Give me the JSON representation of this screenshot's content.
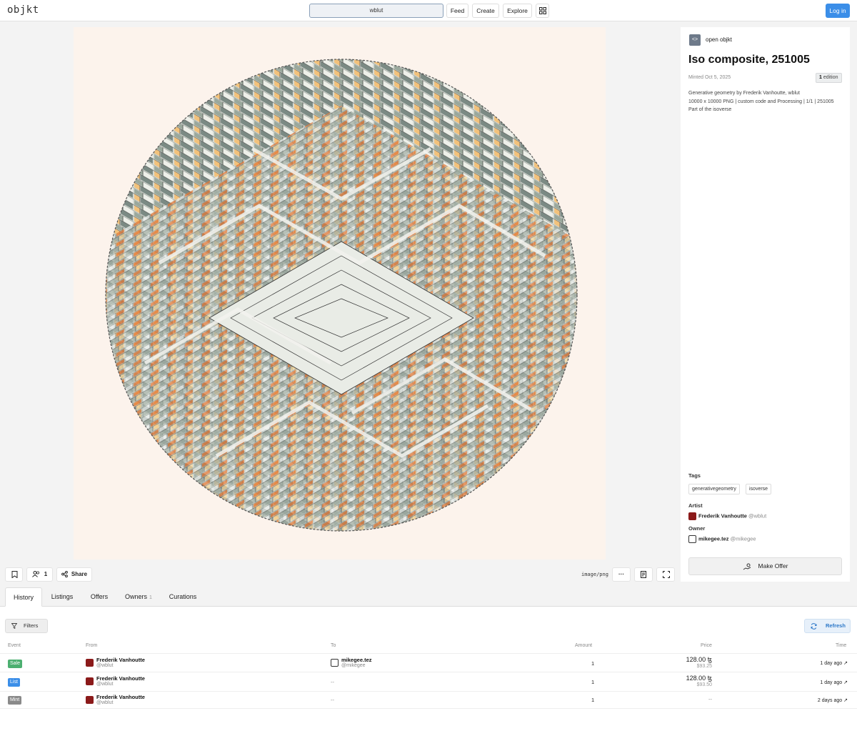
{
  "header": {
    "logo": "objkt",
    "search_value": "wblut",
    "nav": [
      "Feed",
      "Create",
      "Explore"
    ],
    "login_label": "Log in"
  },
  "token": {
    "collection_name": "open objkt",
    "title": "Iso composite, 251005",
    "minted": "Minted Oct 5, 2025",
    "edition_count": "1",
    "edition_label": "edition",
    "description": [
      "Generative geometry by Frederik Vanhoutte, wblut",
      "10000 x 10000 PNG | custom code and Processing | 1/1 | 251005",
      "Part of the isoverse"
    ],
    "tags_label": "Tags",
    "tags": [
      "generativegeometry",
      "isoverse"
    ],
    "artist_label": "Artist",
    "artist_name": "Frederik Vanhoutte",
    "artist_handle": "@wblut",
    "owner_label": "Owner",
    "owner_name": "mikegee.tez",
    "owner_handle": "@mikegee",
    "make_offer_label": "Make Offer"
  },
  "media_bar": {
    "owners_count": "1",
    "share_label": "Share",
    "mime": "image/png"
  },
  "tabs": [
    {
      "label": "History",
      "count": ""
    },
    {
      "label": "Listings",
      "count": ""
    },
    {
      "label": "Offers",
      "count": ""
    },
    {
      "label": "Owners",
      "count": "1"
    },
    {
      "label": "Curations",
      "count": ""
    }
  ],
  "history": {
    "filters_label": "Filters",
    "refresh_label": "Refresh",
    "columns": [
      "Event",
      "From",
      "To",
      "Amount",
      "Price",
      "Time"
    ],
    "rows": [
      {
        "event": "Sale",
        "from_name": "Frederik Vanhoutte",
        "from_handle": "@wblut",
        "to_name": "mikegee.tez",
        "to_handle": "@mikegee",
        "amount": "1",
        "price": "128.00 ꜩ",
        "price_usd": "$93.25",
        "time": "1 day ago"
      },
      {
        "event": "List",
        "from_name": "Frederik Vanhoutte",
        "from_handle": "@wblut",
        "to_name": "--",
        "to_handle": "",
        "amount": "1",
        "price": "128.00 ꜩ",
        "price_usd": "$93.50",
        "time": "1 day ago"
      },
      {
        "event": "Mint",
        "from_name": "Frederik Vanhoutte",
        "from_handle": "@wblut",
        "to_name": "--",
        "to_handle": "",
        "amount": "1",
        "price": "--",
        "price_usd": "",
        "time": "2 days ago"
      }
    ]
  },
  "colors": {
    "accent": "#3b8ee8",
    "sale": "#4caf70",
    "list": "#3b8ee8",
    "mint": "#8a8a8a",
    "artwork_bg": "#fcf3ec"
  }
}
